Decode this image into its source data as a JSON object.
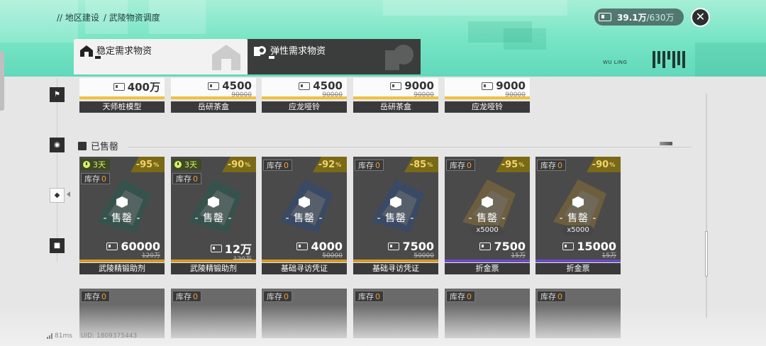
{
  "header": {
    "breadcrumb": [
      "// 地区建设",
      "/ 武陵物资调度"
    ],
    "resource": {
      "current": "39.1万",
      "max": "/630万"
    },
    "close_label": "✕",
    "brand": "WU LING"
  },
  "tabs": [
    {
      "label": "稳定需求物资",
      "active": true
    },
    {
      "label": "弹性需求物资",
      "active": false
    }
  ],
  "top_row": [
    {
      "price": "400万",
      "orig": "",
      "name": "天师桩模型"
    },
    {
      "price": "4500",
      "orig": "90000",
      "name": "岳研茶盒"
    },
    {
      "price": "4500",
      "orig": "90000",
      "name": "应龙哑铃"
    },
    {
      "price": "9000",
      "orig": "90000",
      "name": "岳研茶盒"
    },
    {
      "price": "9000",
      "orig": "90000",
      "name": "应龙哑铃"
    }
  ],
  "section": {
    "title": "已售罄"
  },
  "cards": [
    {
      "timer": "3天",
      "stock_label": "库存",
      "stock": "0",
      "discount": "-95",
      "sold": "- 售罄 -",
      "qty": "",
      "price": "60000",
      "orig": "120万",
      "name": "武陵精锻助剂",
      "rarity": "#d39a2b",
      "art_color": "#1f7a66"
    },
    {
      "timer": "3天",
      "stock_label": "库存",
      "stock": "0",
      "discount": "-90",
      "sold": "- 售罄 -",
      "qty": "",
      "price": "12万",
      "orig": "120万",
      "name": "武陵精锻助剂",
      "rarity": "#d39a2b",
      "art_color": "#1f7a66"
    },
    {
      "timer": "",
      "stock_label": "库存",
      "stock": "0",
      "discount": "-92",
      "sold": "- 售罄 -",
      "qty": "",
      "price": "4000",
      "orig": "50000",
      "name": "基础寻访凭证",
      "rarity": "#d39a2b",
      "art_color": "#2d5fae"
    },
    {
      "timer": "",
      "stock_label": "库存",
      "stock": "0",
      "discount": "-85",
      "sold": "- 售罄 -",
      "qty": "",
      "price": "7500",
      "orig": "50000",
      "name": "基础寻访凭证",
      "rarity": "#d39a2b",
      "art_color": "#2d5fae"
    },
    {
      "timer": "",
      "stock_label": "库存",
      "stock": "0",
      "discount": "-95",
      "sold": "- 售罄 -",
      "qty": "x5000",
      "price": "7500",
      "orig": "15万",
      "name": "折金票",
      "rarity": "#6b4bc4",
      "art_color": "#c59a3a"
    },
    {
      "timer": "",
      "stock_label": "库存",
      "stock": "0",
      "discount": "-90",
      "sold": "- 售罄 -",
      "qty": "x5000",
      "price": "15000",
      "orig": "15万",
      "name": "折金票",
      "rarity": "#6b4bc4",
      "art_color": "#c59a3a"
    }
  ],
  "bottom_row": [
    {
      "stock_label": "库存",
      "stock": "0"
    },
    {
      "stock_label": "库存",
      "stock": "0"
    },
    {
      "stock_label": "库存",
      "stock": "0"
    },
    {
      "stock_label": "库存",
      "stock": "0"
    },
    {
      "stock_label": "库存",
      "stock": "0"
    },
    {
      "stock_label": "库存",
      "stock": "0"
    }
  ],
  "footer": {
    "ping": "81ms",
    "uid": "UID: 1809375443"
  },
  "colors": {
    "accent": "#63d8bb",
    "gold": "#f0c040",
    "purple": "#6b4bc4"
  }
}
